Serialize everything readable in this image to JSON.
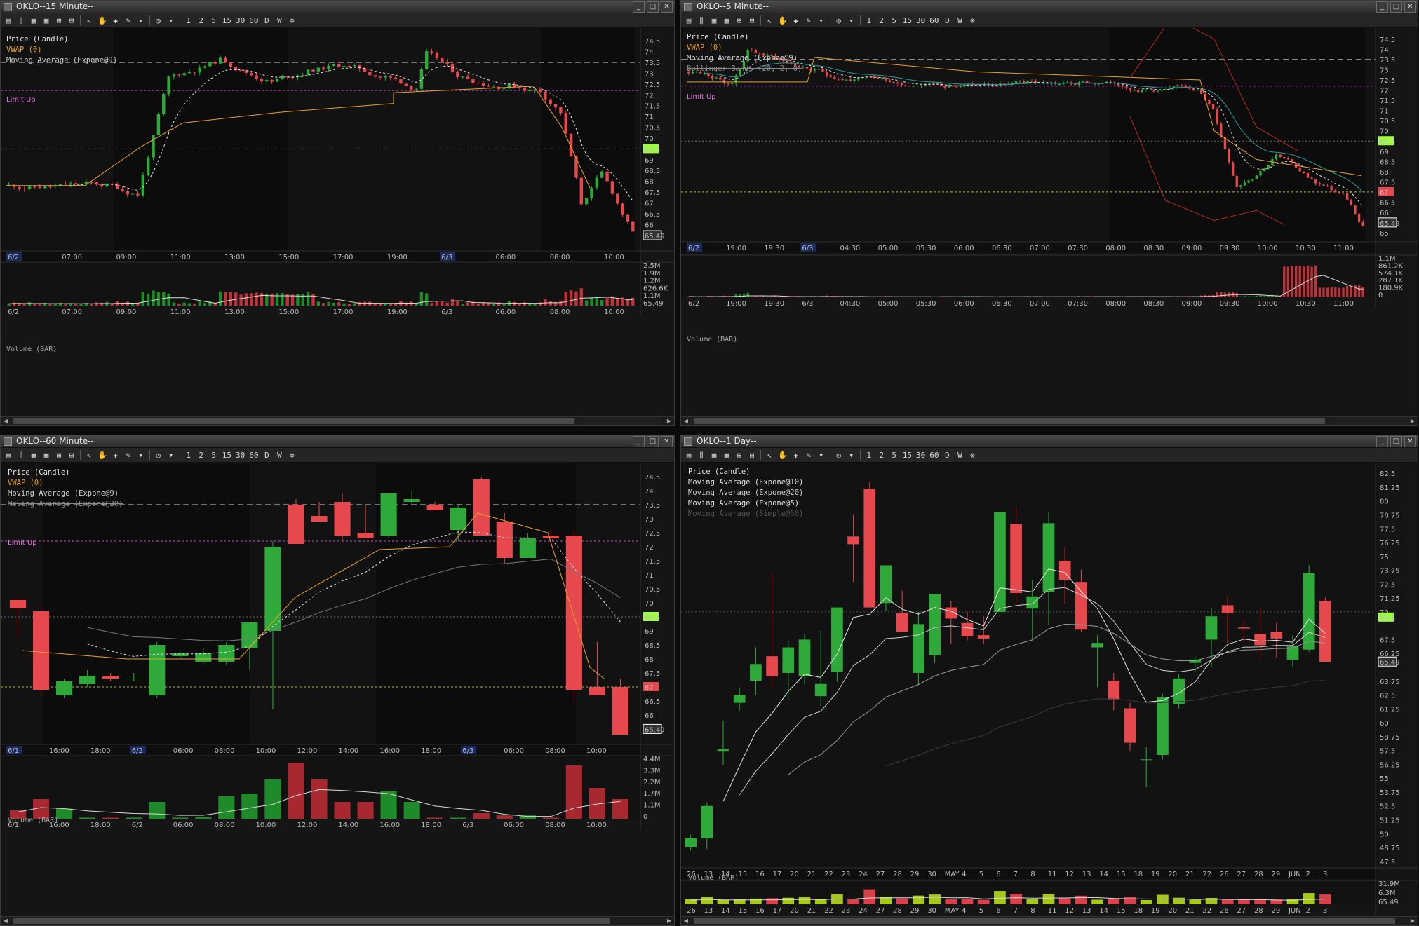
{
  "panes": [
    {
      "id": "p15",
      "title": "OKLO--15 Minute--",
      "legend": [
        {
          "text": "Price (Candle)",
          "cls": "lg-price"
        },
        {
          "text": "VWAP (0)",
          "cls": "lg-vwap"
        },
        {
          "text": "Moving Average (Expone@9)",
          "cls": "lg-ma"
        }
      ],
      "limit_label": "Limit Up",
      "price_ticks": [
        "74.5",
        "74",
        "73.5",
        "73",
        "72.5",
        "72",
        "71.5",
        "71",
        "70.5",
        "70",
        "69.5",
        "69",
        "68.5",
        "68",
        "67.5",
        "67",
        "66.5",
        "66",
        "65.49"
      ],
      "time_ticks": [
        "6/2",
        "07:00",
        "09:00",
        "11:00",
        "13:00",
        "15:00",
        "17:00",
        "19:00",
        "6/3",
        "06:00",
        "08:00",
        "10:00"
      ],
      "volume_label": "Volume (BAR)",
      "volume_ticks": [
        "2.5M",
        "1.9M",
        "1.2M",
        "626.6K",
        "1.1M",
        "65.49"
      ]
    },
    {
      "id": "p5",
      "title": "OKLO--5 Minute--",
      "legend": [
        {
          "text": "Price (Candle)",
          "cls": "lg-price"
        },
        {
          "text": "VWAP (0)",
          "cls": "lg-vwap"
        },
        {
          "text": "Moving Average (Expone@9)",
          "cls": "lg-ma"
        },
        {
          "text": "Bollinger Bands (20, 2, 0)",
          "cls": "lg-ma2"
        }
      ],
      "limit_label": "Limit Up",
      "price_ticks": [
        "74.5",
        "74",
        "73.5",
        "73",
        "72.5",
        "72",
        "71.5",
        "71",
        "70.5",
        "70",
        "69.5",
        "69",
        "68.5",
        "68",
        "67.5",
        "67",
        "66.5",
        "66",
        "65.49",
        "65"
      ],
      "time_ticks": [
        "6/2",
        "19:00",
        "19:30",
        "6/3",
        "04:30",
        "05:00",
        "05:30",
        "06:00",
        "06:30",
        "07:00",
        "07:30",
        "08:00",
        "08:30",
        "09:00",
        "09:30",
        "10:00",
        "10:30",
        "11:00"
      ],
      "volume_label": "Volume (BAR)",
      "volume_ticks": [
        "1.1M",
        "861.2K",
        "574.1K",
        "287.1K",
        "180.9K",
        "0"
      ]
    },
    {
      "id": "p60",
      "title": "OKLO--60 Minute--",
      "legend": [
        {
          "text": "Price (Candle)",
          "cls": "lg-price"
        },
        {
          "text": "VWAP (0)",
          "cls": "lg-vwap"
        },
        {
          "text": "Moving Average (Expone@9)",
          "cls": "lg-ma"
        },
        {
          "text": "Moving Average (Expone@20)",
          "cls": "lg-ma2"
        }
      ],
      "limit_label": "Limit Up",
      "price_ticks": [
        "74.5",
        "74",
        "73.5",
        "73",
        "72.5",
        "72",
        "71.5",
        "71",
        "70.5",
        "70",
        "69.5",
        "69",
        "68.5",
        "68",
        "67.5",
        "67",
        "66.5",
        "66",
        "65.49"
      ],
      "time_ticks": [
        "6/1",
        "16:00",
        "18:00",
        "6/2",
        "06:00",
        "08:00",
        "10:00",
        "12:00",
        "14:00",
        "16:00",
        "18:00",
        "6/3",
        "06:00",
        "08:00",
        "10:00"
      ],
      "volume_label": "Volume (BAR)",
      "volume_ticks": [
        "4.4M",
        "3.3M",
        "2.2M",
        "1.7M",
        "1.1M",
        "0"
      ]
    },
    {
      "id": "p1d",
      "title": "OKLO--1 Day--",
      "legend": [
        {
          "text": "Price (Candle)",
          "cls": "lg-price"
        },
        {
          "text": "Moving Average (Expone@10)",
          "cls": "lg-price"
        },
        {
          "text": "Moving Average (Expone@20)",
          "cls": "lg-ma"
        },
        {
          "text": "Moving Average (Expone@5)",
          "cls": "lg-price"
        },
        {
          "text": "Moving Average (Simple@50)",
          "cls": "lg-dim"
        }
      ],
      "limit_label": "",
      "price_ticks": [
        "82.5",
        "81.25",
        "80",
        "78.75",
        "77.5",
        "76.25",
        "75",
        "73.75",
        "72.5",
        "71.25",
        "70",
        "69.5",
        "67.5",
        "66.25",
        "65.49",
        "63.75",
        "62.5",
        "61.25",
        "60",
        "58.75",
        "57.5",
        "56.25",
        "55",
        "53.75",
        "52.5",
        "51.25",
        "50",
        "48.75",
        "47.5"
      ],
      "time_ticks": [
        "26",
        "13",
        "14",
        "15",
        "16",
        "17",
        "20",
        "21",
        "22",
        "23",
        "24",
        "27",
        "28",
        "29",
        "30",
        "MAY",
        "4",
        "5",
        "6",
        "7",
        "8",
        "11",
        "12",
        "13",
        "14",
        "15",
        "18",
        "19",
        "20",
        "21",
        "22",
        "26",
        "27",
        "28",
        "29",
        "JUN",
        "2",
        "3"
      ],
      "volume_label": "Volume (BAR)",
      "volume_ticks": [
        "31.9M",
        "6.3M",
        "65.49"
      ]
    }
  ],
  "toolbar": [
    "1",
    "2",
    "5",
    "15",
    "30",
    "60",
    "D",
    "W"
  ],
  "colors": {
    "up": "#2faa3a",
    "down": "#e5484d",
    "vwap": "#e8a12a",
    "limit": "#c050c0",
    "last_price": "#9bff3a"
  }
}
